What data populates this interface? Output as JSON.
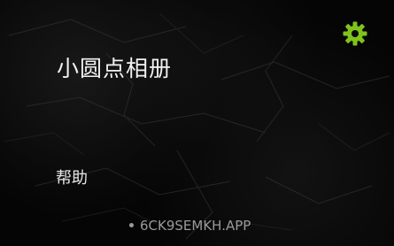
{
  "app": {
    "title": "小圆点相册",
    "help_label": "帮助",
    "footer_text": "6CK9SEMKH.APP"
  },
  "icons": {
    "settings": "gear-icon",
    "footer_bullet": "dot-icon"
  },
  "colors": {
    "accent": "#7fc31c",
    "background": "#000000",
    "text_primary": "#f2f2f2",
    "text_secondary": "#9a9a9a"
  }
}
